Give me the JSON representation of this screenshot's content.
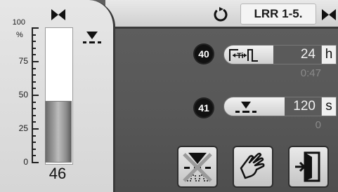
{
  "header": {
    "title": "LRR 1-5.",
    "restart_icon": "restart-icon",
    "valve_icon": "valve-icon"
  },
  "level": {
    "unit": "%",
    "value": "46",
    "fill_percent": 46,
    "scale": [
      "100",
      "75",
      "50",
      "25",
      "0"
    ],
    "level_symbol": "level-down-symbol"
  },
  "params": [
    {
      "badge": "40",
      "icon": "interval-timer-icon",
      "value": "24",
      "unit": "h",
      "sub": "0:47"
    },
    {
      "badge": "41",
      "icon": "level-down-icon",
      "value": "120",
      "unit": "s",
      "sub": "0"
    }
  ],
  "buttons": [
    {
      "icon": "blowdown-disabled-icon"
    },
    {
      "icon": "manual-hand-icon"
    },
    {
      "icon": "exit-door-icon"
    }
  ],
  "colors": {
    "background": "#5a5a5a",
    "panel": "#dcdcdc",
    "value_bg": "#5a5a5a"
  }
}
